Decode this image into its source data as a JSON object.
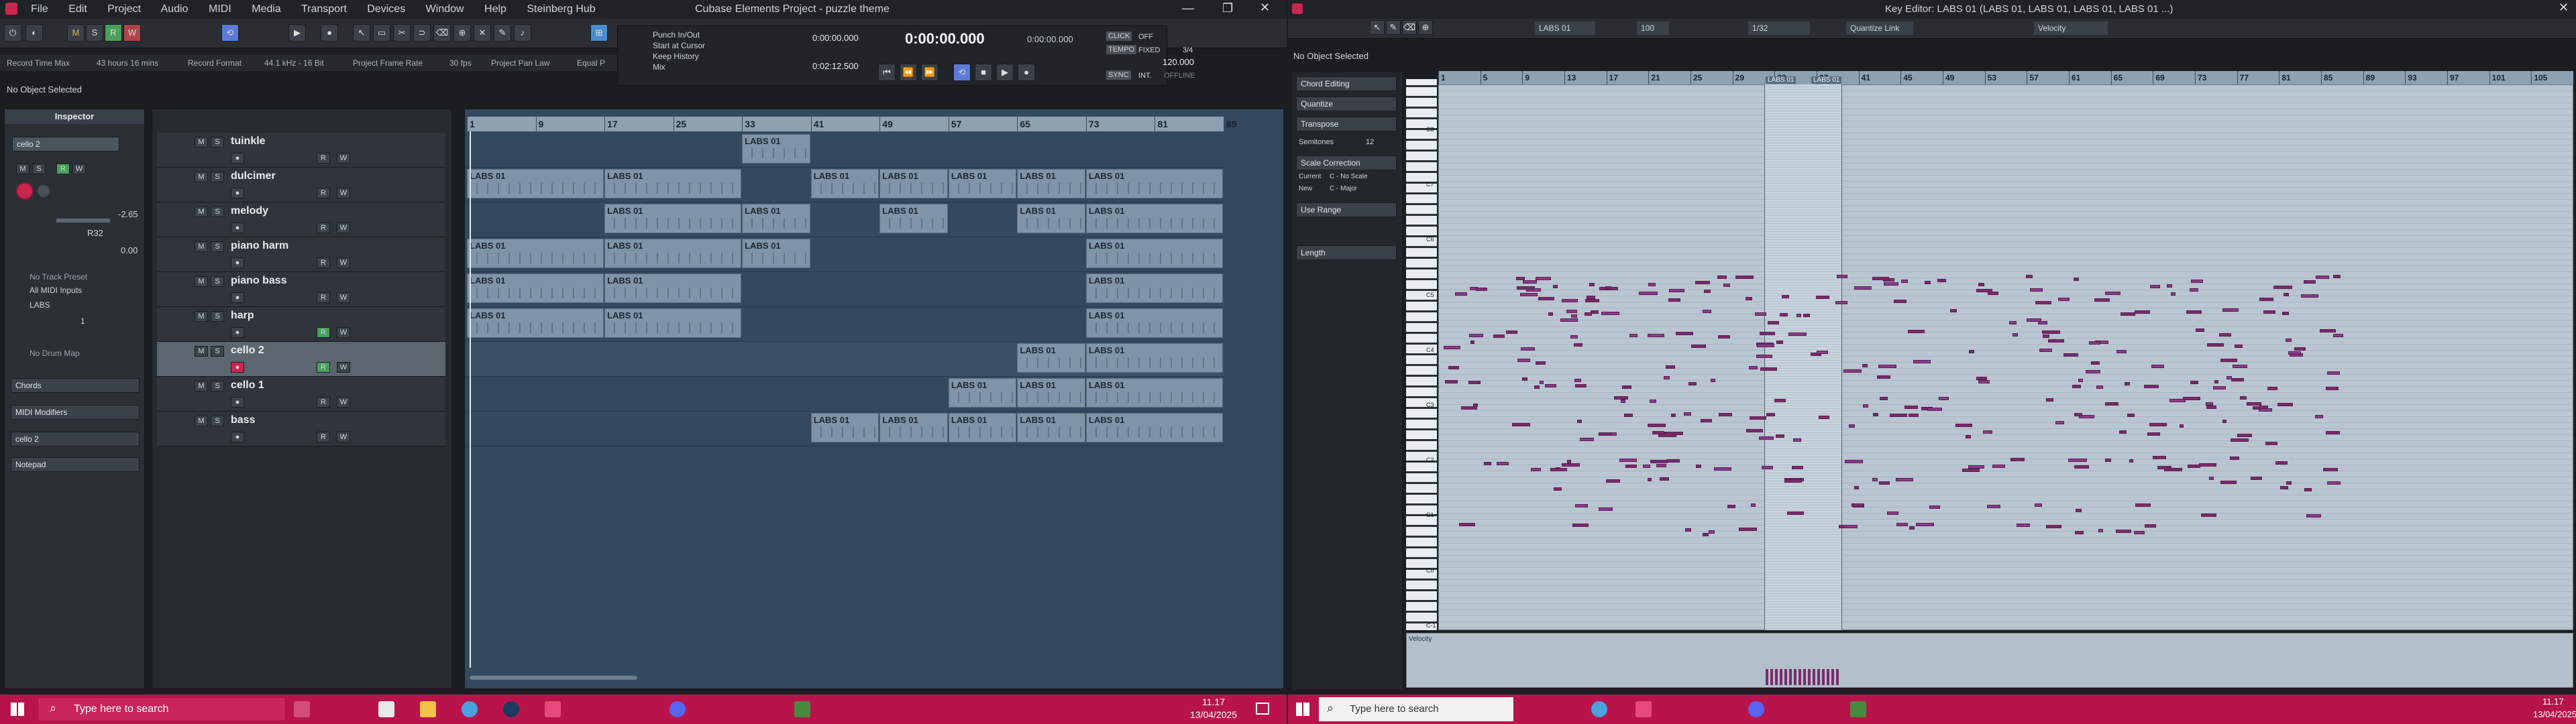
{
  "left_window": {
    "title": "Cubase Elements Project - puzzle theme",
    "menu": [
      "File",
      "Edit",
      "Project",
      "Audio",
      "MIDI",
      "Media",
      "Transport",
      "Devices",
      "Window",
      "Help",
      "Steinberg Hub"
    ],
    "infoline": [
      {
        "label": "Record Time Max",
        "value": "43 hours 16 mins"
      },
      {
        "label": "Record Format",
        "value": "44.1 kHz - 16 Bit"
      },
      {
        "label": "Project Frame Rate",
        "value": "30 fps"
      },
      {
        "label": "Project Pan Law",
        "value": "Equal P"
      }
    ],
    "status": "No Object Selected",
    "transport": {
      "punch_in_out": "Punch In/Out",
      "start_at_cursor": "Start at Cursor",
      "keep_history": "Keep History",
      "mix": "Mix",
      "left_locator": "0:00:00.000",
      "right_locator": "0:02:12.500",
      "position": "0:00:00.000",
      "position2": "0:00:00.000",
      "tempo": "120.000",
      "signature": "3/4",
      "click": "CLICK",
      "click_state": "OFF",
      "tempo_label": "TEMPO",
      "tempo_mode": "FIXED",
      "sync": "SYNC",
      "sync_src": "INT.",
      "sync_state": "OFFLINE",
      "counter_zero": "0",
      "counter_r": "R"
    },
    "inspector": {
      "title": "Inspector",
      "track": "cello 2",
      "volume": "-2.65",
      "pan": "0.00",
      "pan_label": "R32",
      "track_preset": "No Track Preset",
      "midi_in": "All MIDI Inputs",
      "output": "LABS",
      "channel": "1",
      "drum_map": "No Drum Map",
      "sections": [
        "Chords",
        "MIDI Modifiers",
        "cello 2",
        "Notepad"
      ]
    },
    "ruler": [
      "1",
      "9",
      "17",
      "25",
      "33",
      "41",
      "49",
      "57",
      "65",
      "73",
      "81",
      "89"
    ],
    "tracks": [
      {
        "name": "tuinkle",
        "events": [
          {
            "label": "LABS 01",
            "start": 33,
            "end": 41
          }
        ]
      },
      {
        "name": "dulcimer",
        "events": [
          {
            "label": "LABS 01",
            "start": 1,
            "end": 17
          },
          {
            "label": "LABS 01",
            "start": 17,
            "end": 33
          },
          {
            "label": "LABS 01",
            "start": 41,
            "end": 49
          },
          {
            "label": "LABS 01",
            "start": 49,
            "end": 57
          },
          {
            "label": "LABS 01",
            "start": 57,
            "end": 65
          },
          {
            "label": "LABS 01",
            "start": 65,
            "end": 73
          },
          {
            "label": "LABS 01",
            "start": 73,
            "end": 89
          }
        ]
      },
      {
        "name": "melody",
        "events": [
          {
            "label": "LABS 01",
            "start": 17,
            "end": 33
          },
          {
            "label": "LABS 01",
            "start": 33,
            "end": 41
          },
          {
            "label": "LABS 01",
            "start": 49,
            "end": 57
          },
          {
            "label": "LABS 01",
            "start": 65,
            "end": 73
          },
          {
            "label": "LABS 01",
            "start": 73,
            "end": 89
          }
        ]
      },
      {
        "name": "piano harm",
        "events": [
          {
            "label": "LABS 01",
            "start": 1,
            "end": 17
          },
          {
            "label": "LABS 01",
            "start": 17,
            "end": 33
          },
          {
            "label": "LABS 01",
            "start": 33,
            "end": 41
          },
          {
            "label": "LABS 01",
            "start": 73,
            "end": 89
          }
        ]
      },
      {
        "name": "piano bass",
        "events": [
          {
            "label": "LABS 01",
            "start": 1,
            "end": 17
          },
          {
            "label": "LABS 01",
            "start": 17,
            "end": 33
          },
          {
            "label": "LABS 01",
            "start": 73,
            "end": 89
          }
        ]
      },
      {
        "name": "harp",
        "events": [
          {
            "label": "LABS 01",
            "start": 1,
            "end": 17
          },
          {
            "label": "LABS 01",
            "start": 17,
            "end": 33
          },
          {
            "label": "LABS 01",
            "start": 73,
            "end": 89
          }
        ]
      },
      {
        "name": "cello 2",
        "selected": true,
        "automation": "Volume",
        "automation_value": "-2.65",
        "events": [
          {
            "label": "LABS 01",
            "start": 65,
            "end": 73
          },
          {
            "label": "LABS 01",
            "start": 73,
            "end": 89
          }
        ]
      },
      {
        "name": "cello 1",
        "events": [
          {
            "label": "LABS 01",
            "start": 57,
            "end": 65
          },
          {
            "label": "LABS 01",
            "start": 65,
            "end": 73
          },
          {
            "label": "LABS 01",
            "start": 73,
            "end": 89
          }
        ]
      },
      {
        "name": "bass",
        "events": [
          {
            "label": "LABS 01",
            "start": 41,
            "end": 49
          },
          {
            "label": "LABS 01",
            "start": 49,
            "end": 57
          },
          {
            "label": "LABS 01",
            "start": 57,
            "end": 65
          },
          {
            "label": "LABS 01",
            "start": 65,
            "end": 73
          },
          {
            "label": "LABS 01",
            "start": 73,
            "end": 89
          }
        ]
      }
    ]
  },
  "right_window": {
    "title": "Key Editor: LABS 01 (LABS 01, LABS 01, LABS 01, LABS 01 ...)",
    "status": "No Object Selected",
    "toolbar": {
      "part": "LABS 01",
      "velocity_value": "100",
      "quantize": "1/32",
      "quantize_link": "Quantize Link",
      "controller": "Velocity"
    },
    "panels": [
      "Chord Editing",
      "Quantize",
      "Transpose",
      "Scale Correction",
      "Use Range",
      "Length"
    ],
    "transpose": {
      "label": "Semitones",
      "value": "12"
    },
    "scale": {
      "current_label": "Current",
      "current_value": "C - No Scale",
      "new_label": "New",
      "new_value": "C - Major"
    },
    "ruler": [
      "1",
      "5",
      "9",
      "13",
      "17",
      "21",
      "25",
      "29",
      "33",
      "37",
      "41",
      "45",
      "49",
      "53",
      "57",
      "61",
      "65",
      "69",
      "73",
      "77",
      "81",
      "85",
      "89",
      "93",
      "97",
      "101",
      "105"
    ],
    "part_labels": [
      "LABS 01",
      "LABS 01"
    ],
    "octaves": [
      "C8",
      "C7",
      "C6",
      "C5",
      "C4",
      "C3",
      "C2",
      "C1",
      "C0",
      "C-1"
    ],
    "lane_label": "Velocity"
  },
  "taskbar": {
    "search_placeholder": "Type here to search",
    "time": "11.17",
    "date": "13/04/2025",
    "search_placeholder_right": "Type here to search",
    "time_right": "11.17",
    "date_right": "13/04/2025"
  }
}
